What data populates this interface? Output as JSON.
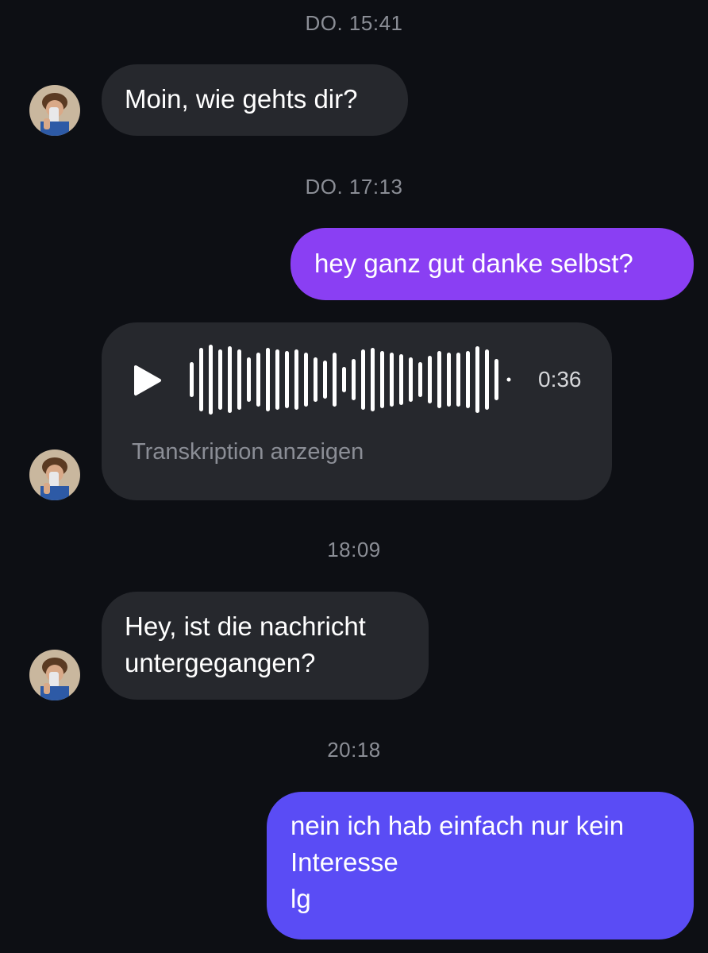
{
  "colors": {
    "background": "#0d0f14",
    "incoming_bubble": "#26282d",
    "outgoing_bubble_1": "#8a3ff3",
    "outgoing_bubble_2": "#5a4cf5",
    "timestamp_text": "#8b8e96"
  },
  "messages": {
    "ts1": "DO. 15:41",
    "msg1": "Moin, wie gehts dir?",
    "ts2": "DO. 17:13",
    "msg2": "hey ganz gut danke selbst?",
    "voice": {
      "play_icon": "play-icon",
      "duration": "0:36",
      "transcript_label": "Transkription anzeigen"
    },
    "ts3": "18:09",
    "msg3": "Hey, ist die nachricht untergegangen?",
    "ts4": "20:18",
    "msg4": "nein ich hab einfach nur kein Interesse lg"
  }
}
